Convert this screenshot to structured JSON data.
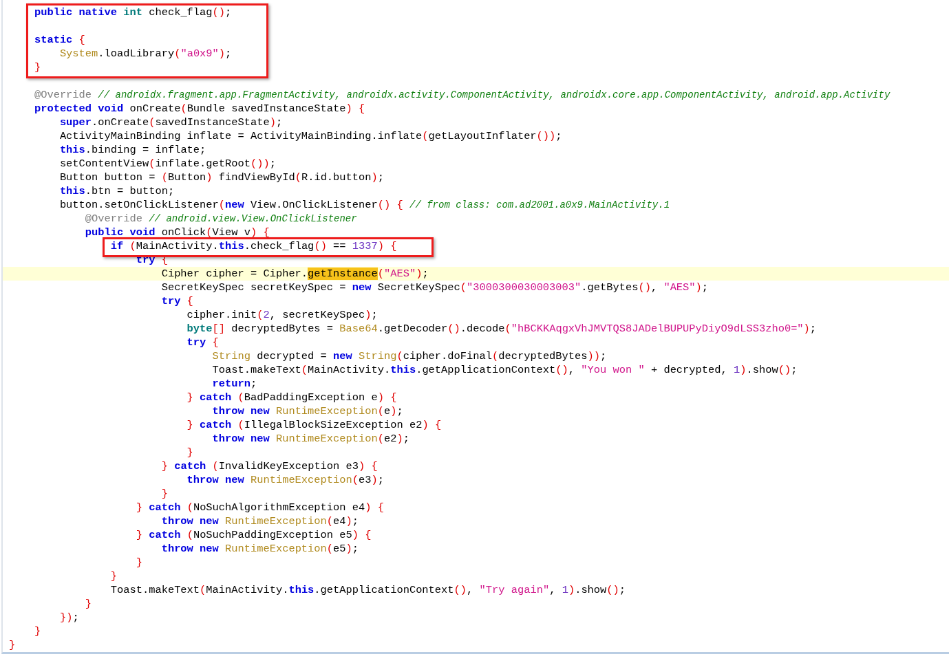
{
  "editor": {
    "blocks": [
      {
        "boxed": true,
        "lines": [
          {
            "kind": "code",
            "highlighted": false,
            "tokens": [
              {
                "kind": "keyword",
                "text": "    public native "
              },
              {
                "kind": "primitive",
                "text": "int"
              },
              {
                "kind": "plain",
                "text": " check_flag();"
              }
            ]
          },
          {
            "kind": "blank"
          },
          {
            "kind": "code",
            "highlighted": false,
            "tokens": [
              {
                "kind": "keyword",
                "text": "    static "
              },
              {
                "kind": "plain",
                "text": "{"
              }
            ]
          },
          {
            "kind": "code",
            "highlighted": false,
            "tokens": [
              {
                "kind": "type",
                "text": "        System"
              },
              {
                "kind": "plain",
                "text": ".loadLibrary("
              },
              {
                "kind": "string",
                "text": "\"a0x9\""
              },
              {
                "kind": "plain",
                "text": ");"
              }
            ]
          },
          {
            "kind": "code",
            "highlighted": false,
            "tokens": [
              {
                "kind": "plain",
                "text": "    }"
              }
            ]
          }
        ]
      },
      {
        "boxed": false,
        "lines": [
          {
            "kind": "blank"
          },
          {
            "kind": "code",
            "highlighted": false,
            "tokens": [
              {
                "kind": "annotation",
                "text": "    @Override "
              },
              {
                "kind": "comment",
                "text": "// androidx.fragment.app.FragmentActivity, androidx.activity.ComponentActivity, androidx.core.app.ComponentActivity, android.app.Activity"
              }
            ]
          },
          {
            "kind": "code",
            "highlighted": false,
            "tokens": [
              {
                "kind": "keyword",
                "text": "    protected void "
              },
              {
                "kind": "plain",
                "text": "onCreate(Bundle savedInstanceState) {"
              }
            ]
          },
          {
            "kind": "code",
            "highlighted": false,
            "tokens": [
              {
                "kind": "keyword",
                "text": "        super"
              },
              {
                "kind": "plain",
                "text": ".onCreate(savedInstanceState);"
              }
            ]
          },
          {
            "kind": "code",
            "highlighted": false,
            "tokens": [
              {
                "kind": "plain",
                "text": "        ActivityMainBinding inflate = ActivityMainBinding.inflate(getLayoutInflater());"
              }
            ]
          },
          {
            "kind": "code",
            "highlighted": false,
            "tokens": [
              {
                "kind": "keyword",
                "text": "        this"
              },
              {
                "kind": "plain",
                "text": ".binding = inflate;"
              }
            ]
          },
          {
            "kind": "code",
            "highlighted": false,
            "tokens": [
              {
                "kind": "plain",
                "text": "        setContentView(inflate.getRoot());"
              }
            ]
          },
          {
            "kind": "code",
            "highlighted": false,
            "tokens": [
              {
                "kind": "plain",
                "text": "        Button button = (Button) findViewById(R.id.button);"
              }
            ]
          },
          {
            "kind": "code",
            "highlighted": false,
            "tokens": [
              {
                "kind": "keyword",
                "text": "        this"
              },
              {
                "kind": "plain",
                "text": ".btn = button;"
              }
            ]
          },
          {
            "kind": "code",
            "highlighted": false,
            "tokens": [
              {
                "kind": "plain",
                "text": "        button.setOnClickListener("
              },
              {
                "kind": "keyword",
                "text": "new"
              },
              {
                "kind": "plain",
                "text": " View.OnClickListener() { "
              },
              {
                "kind": "comment",
                "text": "// from class: com.ad2001.a0x9.MainActivity.1"
              }
            ]
          },
          {
            "kind": "code",
            "highlighted": false,
            "tokens": [
              {
                "kind": "annotation",
                "text": "            @Override "
              },
              {
                "kind": "comment",
                "text": "// android.view.View.OnClickListener"
              }
            ]
          },
          {
            "kind": "code",
            "highlighted": false,
            "tokens": [
              {
                "kind": "keyword",
                "text": "            public void "
              },
              {
                "kind": "plain",
                "text": "onClick(View v) {"
              }
            ]
          }
        ]
      },
      {
        "boxed": true,
        "lines": [
          {
            "kind": "code",
            "highlighted": false,
            "tokens": [
              {
                "kind": "keyword",
                "text": "                if "
              },
              {
                "kind": "plain",
                "text": "(MainActivity."
              },
              {
                "kind": "keyword",
                "text": "this"
              },
              {
                "kind": "plain",
                "text": ".check_flag() == "
              },
              {
                "kind": "number",
                "text": "1337"
              },
              {
                "kind": "plain",
                "text": ") {"
              }
            ]
          }
        ]
      },
      {
        "boxed": false,
        "lines": [
          {
            "kind": "code",
            "highlighted": false,
            "tokens": [
              {
                "kind": "keyword",
                "text": "                    try "
              },
              {
                "kind": "plain",
                "text": "{"
              }
            ]
          },
          {
            "kind": "code",
            "highlighted": true,
            "tokens": [
              {
                "kind": "plain",
                "text": "                        Cipher cipher = Cipher."
              },
              {
                "kind": "match",
                "text": "getInstance"
              },
              {
                "kind": "plain",
                "text": "("
              },
              {
                "kind": "string",
                "text": "\"AES\""
              },
              {
                "kind": "plain",
                "text": ");"
              }
            ]
          },
          {
            "kind": "code",
            "highlighted": false,
            "tokens": [
              {
                "kind": "plain",
                "text": "                        SecretKeySpec secretKeySpec = "
              },
              {
                "kind": "keyword",
                "text": "new"
              },
              {
                "kind": "plain",
                "text": " SecretKeySpec("
              },
              {
                "kind": "string",
                "text": "\"3000300030003003\""
              },
              {
                "kind": "plain",
                "text": ".getBytes(), "
              },
              {
                "kind": "string",
                "text": "\"AES\""
              },
              {
                "kind": "plain",
                "text": ");"
              }
            ]
          },
          {
            "kind": "code",
            "highlighted": false,
            "tokens": [
              {
                "kind": "keyword",
                "text": "                        try "
              },
              {
                "kind": "plain",
                "text": "{"
              }
            ]
          },
          {
            "kind": "code",
            "highlighted": false,
            "tokens": [
              {
                "kind": "plain",
                "text": "                            cipher.init("
              },
              {
                "kind": "number",
                "text": "2"
              },
              {
                "kind": "plain",
                "text": ", secretKeySpec);"
              }
            ]
          },
          {
            "kind": "code",
            "highlighted": false,
            "tokens": [
              {
                "kind": "primitive",
                "text": "                            byte"
              },
              {
                "kind": "plain",
                "text": "[] decryptedBytes = "
              },
              {
                "kind": "type",
                "text": "Base64"
              },
              {
                "kind": "plain",
                "text": ".getDecoder().decode("
              },
              {
                "kind": "string",
                "text": "\"hBCKKAqgxVhJMVTQS8JADelBUPUPyDiyO9dLSS3zho0=\""
              },
              {
                "kind": "plain",
                "text": ");"
              }
            ]
          },
          {
            "kind": "code",
            "highlighted": false,
            "tokens": [
              {
                "kind": "keyword",
                "text": "                            try "
              },
              {
                "kind": "plain",
                "text": "{"
              }
            ]
          },
          {
            "kind": "code",
            "highlighted": false,
            "tokens": [
              {
                "kind": "type",
                "text": "                                String"
              },
              {
                "kind": "plain",
                "text": " decrypted = "
              },
              {
                "kind": "keyword",
                "text": "new "
              },
              {
                "kind": "type",
                "text": "String"
              },
              {
                "kind": "plain",
                "text": "(cipher.doFinal(decryptedBytes));"
              }
            ]
          },
          {
            "kind": "code",
            "highlighted": false,
            "tokens": [
              {
                "kind": "plain",
                "text": "                                Toast.makeText(MainActivity."
              },
              {
                "kind": "keyword",
                "text": "this"
              },
              {
                "kind": "plain",
                "text": ".getApplicationContext(), "
              },
              {
                "kind": "string",
                "text": "\"You won \""
              },
              {
                "kind": "plain",
                "text": " + decrypted, "
              },
              {
                "kind": "number",
                "text": "1"
              },
              {
                "kind": "plain",
                "text": ").show();"
              }
            ]
          },
          {
            "kind": "code",
            "highlighted": false,
            "tokens": [
              {
                "kind": "keyword",
                "text": "                                return"
              },
              {
                "kind": "plain",
                "text": ";"
              }
            ]
          },
          {
            "kind": "code",
            "highlighted": false,
            "tokens": [
              {
                "kind": "plain",
                "text": "                            } "
              },
              {
                "kind": "keyword",
                "text": "catch "
              },
              {
                "kind": "plain",
                "text": "(BadPaddingException e) {"
              }
            ]
          },
          {
            "kind": "code",
            "highlighted": false,
            "tokens": [
              {
                "kind": "keyword",
                "text": "                                throw new "
              },
              {
                "kind": "type",
                "text": "RuntimeException"
              },
              {
                "kind": "plain",
                "text": "(e);"
              }
            ]
          },
          {
            "kind": "code",
            "highlighted": false,
            "tokens": [
              {
                "kind": "plain",
                "text": "                            } "
              },
              {
                "kind": "keyword",
                "text": "catch "
              },
              {
                "kind": "plain",
                "text": "(IllegalBlockSizeException e2) {"
              }
            ]
          },
          {
            "kind": "code",
            "highlighted": false,
            "tokens": [
              {
                "kind": "keyword",
                "text": "                                throw new "
              },
              {
                "kind": "type",
                "text": "RuntimeException"
              },
              {
                "kind": "plain",
                "text": "(e2);"
              }
            ]
          },
          {
            "kind": "code",
            "highlighted": false,
            "tokens": [
              {
                "kind": "plain",
                "text": "                            }"
              }
            ]
          },
          {
            "kind": "code",
            "highlighted": false,
            "tokens": [
              {
                "kind": "plain",
                "text": "                        } "
              },
              {
                "kind": "keyword",
                "text": "catch "
              },
              {
                "kind": "plain",
                "text": "(InvalidKeyException e3) {"
              }
            ]
          },
          {
            "kind": "code",
            "highlighted": false,
            "tokens": [
              {
                "kind": "keyword",
                "text": "                            throw new "
              },
              {
                "kind": "type",
                "text": "RuntimeException"
              },
              {
                "kind": "plain",
                "text": "(e3);"
              }
            ]
          },
          {
            "kind": "code",
            "highlighted": false,
            "tokens": [
              {
                "kind": "plain",
                "text": "                        }"
              }
            ]
          },
          {
            "kind": "code",
            "highlighted": false,
            "tokens": [
              {
                "kind": "plain",
                "text": "                    } "
              },
              {
                "kind": "keyword",
                "text": "catch "
              },
              {
                "kind": "plain",
                "text": "(NoSuchAlgorithmException e4) {"
              }
            ]
          },
          {
            "kind": "code",
            "highlighted": false,
            "tokens": [
              {
                "kind": "keyword",
                "text": "                        throw new "
              },
              {
                "kind": "type",
                "text": "RuntimeException"
              },
              {
                "kind": "plain",
                "text": "(e4);"
              }
            ]
          },
          {
            "kind": "code",
            "highlighted": false,
            "tokens": [
              {
                "kind": "plain",
                "text": "                    } "
              },
              {
                "kind": "keyword",
                "text": "catch "
              },
              {
                "kind": "plain",
                "text": "(NoSuchPaddingException e5) {"
              }
            ]
          },
          {
            "kind": "code",
            "highlighted": false,
            "tokens": [
              {
                "kind": "keyword",
                "text": "                        throw new "
              },
              {
                "kind": "type",
                "text": "RuntimeException"
              },
              {
                "kind": "plain",
                "text": "(e5);"
              }
            ]
          },
          {
            "kind": "code",
            "highlighted": false,
            "tokens": [
              {
                "kind": "plain",
                "text": "                    }"
              }
            ]
          },
          {
            "kind": "code",
            "highlighted": false,
            "tokens": [
              {
                "kind": "plain",
                "text": "                }"
              }
            ]
          },
          {
            "kind": "code",
            "highlighted": false,
            "tokens": [
              {
                "kind": "plain",
                "text": "                Toast.makeText(MainActivity."
              },
              {
                "kind": "keyword",
                "text": "this"
              },
              {
                "kind": "plain",
                "text": ".getApplicationContext(), "
              },
              {
                "kind": "string",
                "text": "\"Try again\""
              },
              {
                "kind": "plain",
                "text": ", "
              },
              {
                "kind": "number",
                "text": "1"
              },
              {
                "kind": "plain",
                "text": ").show();"
              }
            ]
          },
          {
            "kind": "code",
            "highlighted": false,
            "tokens": [
              {
                "kind": "plain",
                "text": "            }"
              }
            ]
          },
          {
            "kind": "code",
            "highlighted": false,
            "tokens": [
              {
                "kind": "plain",
                "text": "        });"
              }
            ]
          },
          {
            "kind": "code",
            "highlighted": false,
            "tokens": [
              {
                "kind": "plain",
                "text": "    }"
              }
            ]
          },
          {
            "kind": "code",
            "highlighted": false,
            "tokens": [
              {
                "kind": "plain",
                "text": "}"
              }
            ]
          }
        ]
      }
    ]
  }
}
